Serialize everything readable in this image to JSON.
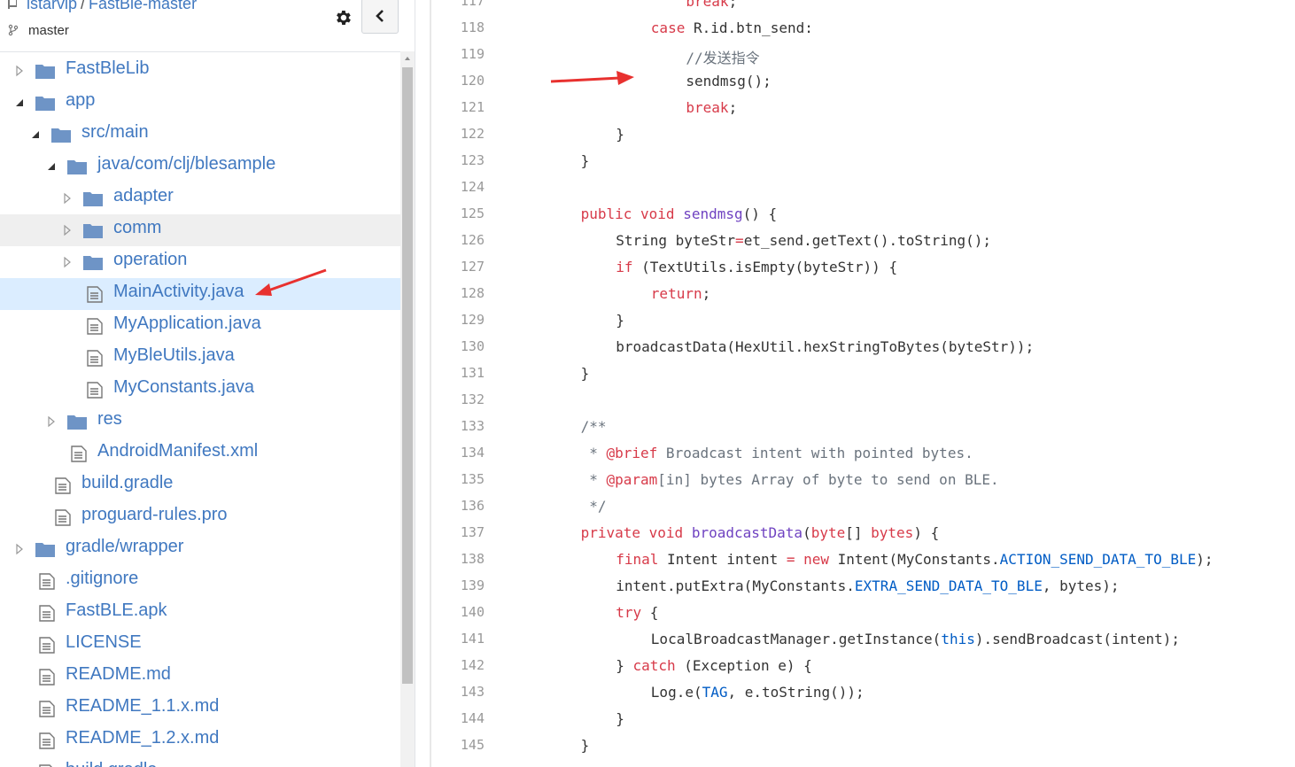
{
  "header": {
    "owner": "istarvip",
    "separator": "/",
    "repo": "FastBle-master",
    "branch": "master"
  },
  "tree": [
    {
      "label": "FastBleLib",
      "type": "folder",
      "expanded": false,
      "depth": 0
    },
    {
      "label": "app",
      "type": "folder",
      "expanded": true,
      "depth": 0
    },
    {
      "label": "src/main",
      "type": "folder",
      "expanded": true,
      "depth": 1
    },
    {
      "label": "java/com/clj/blesample",
      "type": "folder",
      "expanded": true,
      "depth": 2
    },
    {
      "label": "adapter",
      "type": "folder",
      "expanded": false,
      "depth": 3
    },
    {
      "label": "comm",
      "type": "folder",
      "expanded": false,
      "depth": 3,
      "state": "hover"
    },
    {
      "label": "operation",
      "type": "folder",
      "expanded": false,
      "depth": 3
    },
    {
      "label": "MainActivity.java",
      "type": "file",
      "depth": 3,
      "state": "selected"
    },
    {
      "label": "MyApplication.java",
      "type": "file",
      "depth": 3
    },
    {
      "label": "MyBleUtils.java",
      "type": "file",
      "depth": 3
    },
    {
      "label": "MyConstants.java",
      "type": "file",
      "depth": 3
    },
    {
      "label": "res",
      "type": "folder",
      "expanded": false,
      "depth": 2
    },
    {
      "label": "AndroidManifest.xml",
      "type": "file",
      "depth": 2
    },
    {
      "label": "build.gradle",
      "type": "file",
      "depth": 1
    },
    {
      "label": "proguard-rules.pro",
      "type": "file",
      "depth": 1
    },
    {
      "label": "gradle/wrapper",
      "type": "folder",
      "expanded": false,
      "depth": 0
    },
    {
      "label": ".gitignore",
      "type": "file",
      "depth": 0
    },
    {
      "label": "FastBLE.apk",
      "type": "file",
      "depth": 0
    },
    {
      "label": "LICENSE",
      "type": "file",
      "depth": 0
    },
    {
      "label": "README.md",
      "type": "file",
      "depth": 0
    },
    {
      "label": "README_1.1.x.md",
      "type": "file",
      "depth": 0
    },
    {
      "label": "README_1.2.x.md",
      "type": "file",
      "depth": 0
    },
    {
      "label": "build.gradle",
      "type": "file",
      "depth": 0
    }
  ],
  "code": {
    "lines": [
      {
        "n": "117",
        "indent": 4,
        "tokens": [
          [
            "kw",
            "break"
          ],
          [
            "",
            "; "
          ]
        ]
      },
      {
        "n": "118",
        "indent": 3,
        "tokens": [
          [
            "kw",
            "case "
          ],
          [
            "",
            "R"
          ],
          [
            "",
            "."
          ],
          [
            "",
            "id"
          ],
          [
            "",
            "."
          ],
          [
            "",
            "btn_send"
          ],
          [
            "",
            ":"
          ]
        ]
      },
      {
        "n": "119",
        "indent": 4,
        "tokens": [
          [
            "cm",
            "//发送指令"
          ]
        ]
      },
      {
        "n": "120",
        "indent": 4,
        "tokens": [
          [
            "",
            "sendmsg();"
          ]
        ]
      },
      {
        "n": "121",
        "indent": 4,
        "tokens": [
          [
            "kw",
            "break"
          ],
          [
            "",
            ";"
          ]
        ]
      },
      {
        "n": "122",
        "indent": 2,
        "tokens": [
          [
            "",
            "}"
          ]
        ]
      },
      {
        "n": "123",
        "indent": 1,
        "tokens": [
          [
            "",
            "}"
          ]
        ]
      },
      {
        "n": "124",
        "indent": 0,
        "tokens": []
      },
      {
        "n": "125",
        "indent": 1,
        "tokens": [
          [
            "kw",
            "public "
          ],
          [
            "kw",
            "void "
          ],
          [
            "fn",
            "sendmsg"
          ],
          [
            "",
            "() {"
          ]
        ]
      },
      {
        "n": "126",
        "indent": 2,
        "tokens": [
          [
            "",
            "String byteStr"
          ],
          [
            "kw",
            "="
          ],
          [
            "",
            "et_send.getText().toString();"
          ]
        ]
      },
      {
        "n": "127",
        "indent": 2,
        "tokens": [
          [
            "kw",
            "if "
          ],
          [
            "",
            "(TextUtils.isEmpty(byteStr)) {"
          ]
        ]
      },
      {
        "n": "128",
        "indent": 3,
        "tokens": [
          [
            "kw",
            "return"
          ],
          [
            "",
            ";"
          ]
        ]
      },
      {
        "n": "129",
        "indent": 2,
        "tokens": [
          [
            "",
            "}"
          ]
        ]
      },
      {
        "n": "130",
        "indent": 2,
        "tokens": [
          [
            "",
            "broadcastData(HexUtil.hexStringToBytes(byteStr));"
          ]
        ]
      },
      {
        "n": "131",
        "indent": 1,
        "tokens": [
          [
            "",
            "}"
          ]
        ]
      },
      {
        "n": "132",
        "indent": 0,
        "tokens": []
      },
      {
        "n": "133",
        "indent": 1,
        "tokens": [
          [
            "cm",
            "/**"
          ]
        ]
      },
      {
        "n": "134",
        "indent": 1,
        "tokens": [
          [
            "cm",
            " * "
          ],
          [
            "kw",
            "@brief"
          ],
          [
            "cm",
            " Broadcast intent with pointed bytes."
          ]
        ]
      },
      {
        "n": "135",
        "indent": 1,
        "tokens": [
          [
            "cm",
            " * "
          ],
          [
            "kw",
            "@param"
          ],
          [
            "cm",
            "[in] bytes Array of byte to send on BLE."
          ]
        ]
      },
      {
        "n": "136",
        "indent": 1,
        "tokens": [
          [
            "cm",
            " */"
          ]
        ]
      },
      {
        "n": "137",
        "indent": 1,
        "tokens": [
          [
            "kw",
            "private "
          ],
          [
            "kw",
            "void "
          ],
          [
            "fn",
            "broadcastData"
          ],
          [
            "",
            "("
          ],
          [
            "kw",
            "byte"
          ],
          [
            "",
            "[] "
          ],
          [
            "kw",
            "bytes"
          ],
          [
            "",
            ") {"
          ]
        ]
      },
      {
        "n": "138",
        "indent": 2,
        "tokens": [
          [
            "kw",
            "final "
          ],
          [
            "",
            "Intent intent "
          ],
          [
            "kw",
            "= "
          ],
          [
            "kw",
            "new "
          ],
          [
            "",
            "Intent(MyConstants."
          ],
          [
            "cn",
            "ACTION_SEND_DATA_TO_BLE"
          ],
          [
            "",
            ");"
          ]
        ]
      },
      {
        "n": "139",
        "indent": 2,
        "tokens": [
          [
            "",
            "intent.putExtra(MyConstants."
          ],
          [
            "cn",
            "EXTRA_SEND_DATA_TO_BLE"
          ],
          [
            "",
            ", bytes);"
          ]
        ]
      },
      {
        "n": "140",
        "indent": 2,
        "tokens": [
          [
            "kw",
            "try "
          ],
          [
            "",
            "{"
          ]
        ]
      },
      {
        "n": "141",
        "indent": 3,
        "tokens": [
          [
            "",
            "LocalBroadcastManager.getInstance("
          ],
          [
            "cn",
            "this"
          ],
          [
            "",
            ").sendBroadcast(intent);"
          ]
        ]
      },
      {
        "n": "142",
        "indent": 2,
        "tokens": [
          [
            "",
            "} "
          ],
          [
            "kw",
            "catch "
          ],
          [
            "",
            "(Exception e) {"
          ]
        ]
      },
      {
        "n": "143",
        "indent": 3,
        "tokens": [
          [
            "",
            "Log.e("
          ],
          [
            "cn",
            "TAG"
          ],
          [
            "",
            ", e.toString());"
          ]
        ]
      },
      {
        "n": "144",
        "indent": 2,
        "tokens": [
          [
            "",
            "}"
          ]
        ]
      },
      {
        "n": "145",
        "indent": 1,
        "tokens": [
          [
            "",
            "}"
          ]
        ]
      }
    ]
  },
  "colors": {
    "link": "#4078c0",
    "keyword": "#d73a49",
    "selected_row": "#dbedff",
    "annotation_arrow": "#e8312f"
  },
  "icons": [
    "repo-icon",
    "branch-icon",
    "gear-icon",
    "chevron-left-icon",
    "caret-right-icon",
    "caret-down-icon",
    "folder-icon",
    "file-icon",
    "arrow-annotation-icon"
  ]
}
